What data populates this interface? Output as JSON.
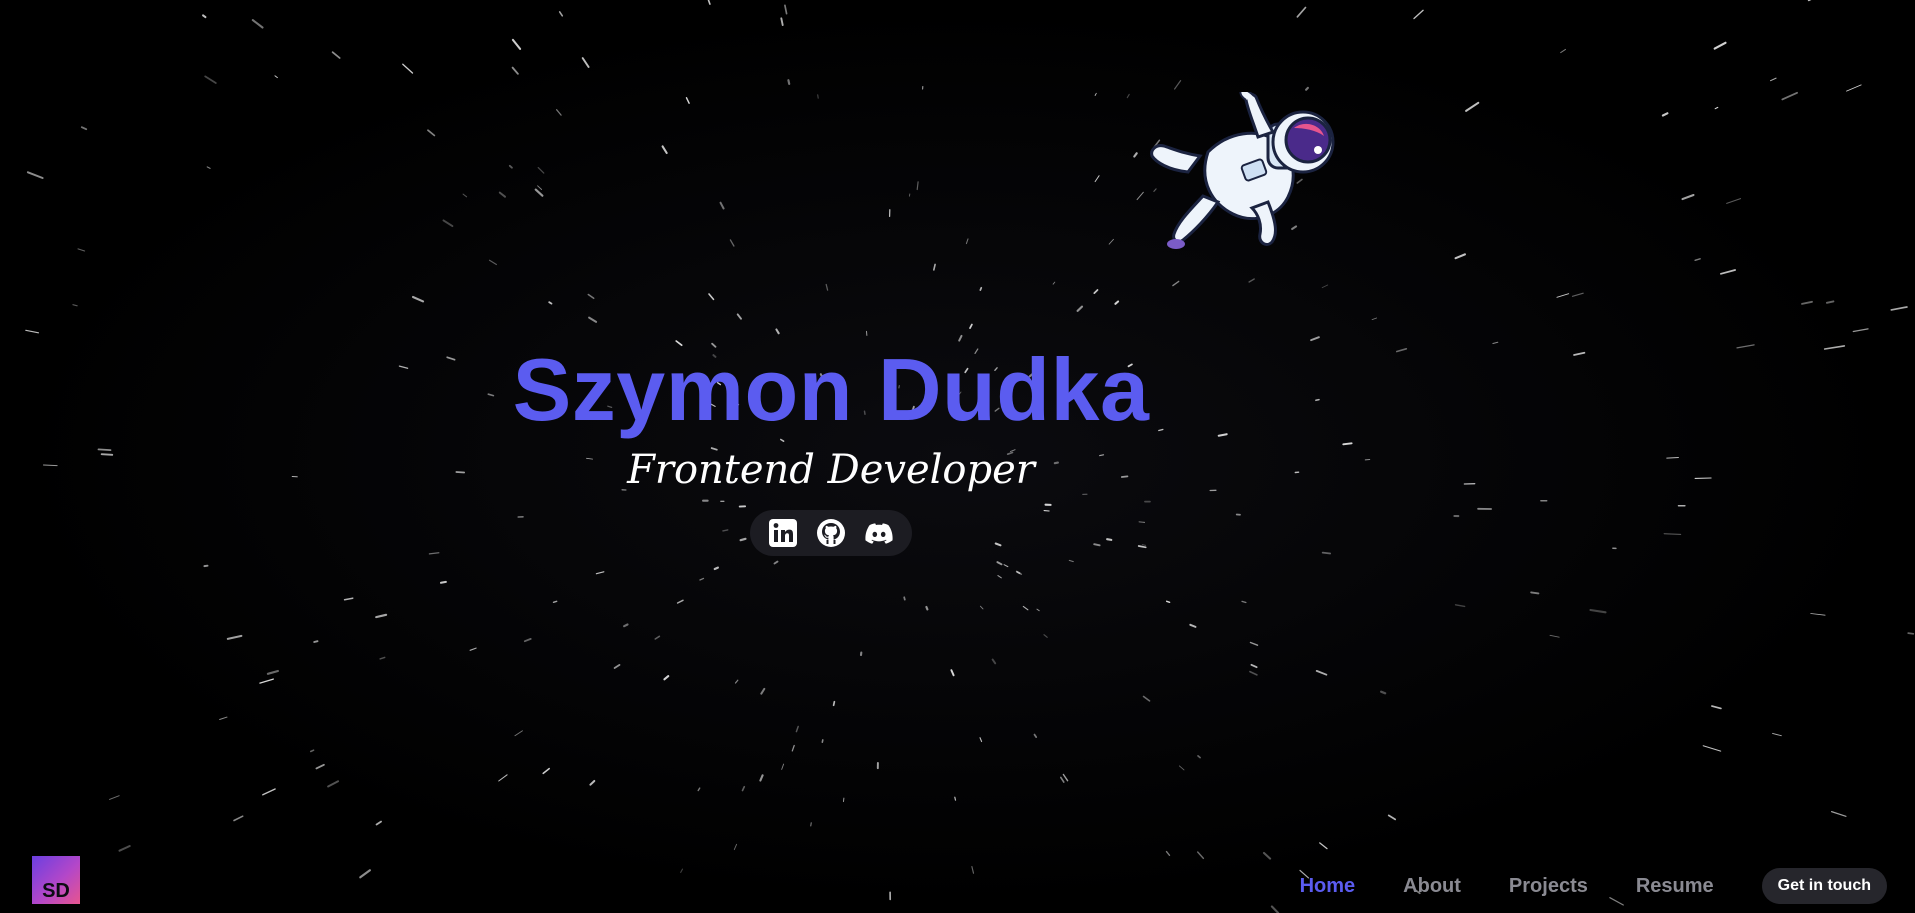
{
  "hero": {
    "name": "Szymon Dudka",
    "role": "Frontend Developer"
  },
  "socials": [
    {
      "label": "LinkedIn",
      "icon": "linkedin-icon"
    },
    {
      "label": "GitHub",
      "icon": "github-icon"
    },
    {
      "label": "Discord",
      "icon": "discord-icon"
    }
  ],
  "logo": {
    "text": "SD"
  },
  "nav": {
    "items": [
      {
        "label": "Home",
        "active": true
      },
      {
        "label": "About",
        "active": false
      },
      {
        "label": "Projects",
        "active": false
      },
      {
        "label": "Resume",
        "active": false
      }
    ],
    "cta_label": "Get in touch"
  },
  "colors": {
    "background": "#000000",
    "accent": "#5b5cf0",
    "nav_inactive": "#8a8a92",
    "pill": "#26262c"
  }
}
